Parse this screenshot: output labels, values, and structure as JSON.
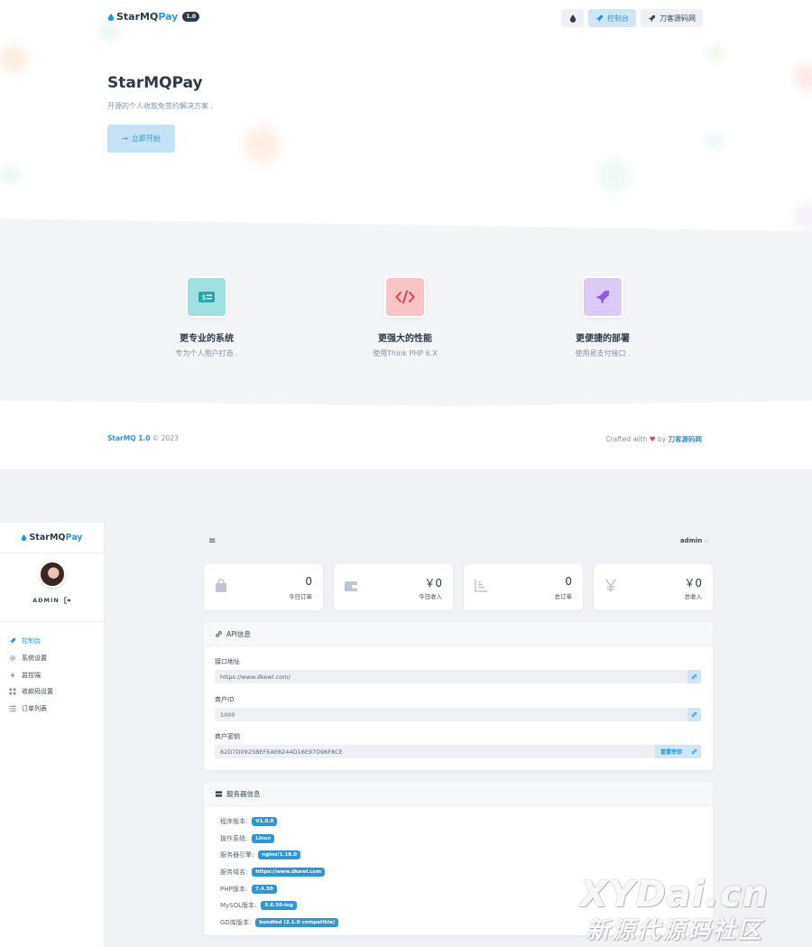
{
  "landing": {
    "logo": {
      "star": "StarMQ",
      "pay": "Pay",
      "version": "1.0"
    },
    "nav": {
      "theme_icon": "drop-icon",
      "console_label": "控制台",
      "site_label": "刀客源码网"
    },
    "hero": {
      "title": "StarMQPay",
      "subtitle": "开源的个人收款免签约解决方案 .",
      "cta_label": "立即开始"
    },
    "features": [
      {
        "icon": "money-icon",
        "color": "#9fe0e0",
        "title": "更专业的系统",
        "desc": "专为个人用户打造 ."
      },
      {
        "icon": "code-icon",
        "color": "#f6c6c6",
        "title": "更强大的性能",
        "desc": "使用Think PHP 6.X"
      },
      {
        "icon": "rocket-icon",
        "color": "#dccbf7",
        "title": "更便捷的部署",
        "desc": "使用易支付接口 ."
      }
    ],
    "footer": {
      "brand": "StarMQ 1.0",
      "copyright": "© 2023",
      "crafted_prefix": "Crafted with",
      "crafted_by": "by",
      "crafted_brand": "刀客源码网"
    }
  },
  "admin": {
    "sidebar": {
      "logo_star": "StarMQ",
      "logo_pay": "Pay",
      "username": "ADMIN",
      "items": [
        {
          "label": "控制台",
          "icon": "rocket-icon",
          "active": true
        },
        {
          "label": "系统设置",
          "icon": "gear-icon",
          "active": false
        },
        {
          "label": "监控端",
          "icon": "bolt-icon",
          "active": false
        },
        {
          "label": "收款码设置",
          "icon": "grid-icon",
          "active": false
        },
        {
          "label": "订单列表",
          "icon": "list-icon",
          "active": false
        }
      ]
    },
    "header": {
      "menu_icon": "≡",
      "user": "admin"
    },
    "stats": [
      {
        "icon": "bag-icon",
        "value": "0",
        "label": "今日订单"
      },
      {
        "icon": "wallet-icon",
        "value": "￥0",
        "label": "今日收入"
      },
      {
        "icon": "chart-icon",
        "value": "0",
        "label": "总订单"
      },
      {
        "icon": "yen-icon",
        "value": "￥0",
        "label": "总收入"
      }
    ],
    "api": {
      "title": "API信息",
      "fields": [
        {
          "label": "接口地址",
          "value": "https://www.dkewl.com/"
        },
        {
          "label": "商户ID",
          "value": "1000"
        },
        {
          "label": "商户密钥",
          "value": "62D7D0925BEFEAE8244D16E97D96F8CE"
        }
      ],
      "reset_label": "重置密钥"
    },
    "server": {
      "title": "服务器信息",
      "rows": [
        {
          "label": "程序版本:",
          "value": "V1.0.0"
        },
        {
          "label": "操作系统:",
          "value": "Linux"
        },
        {
          "label": "服务器引擎:",
          "value": "nginx/1.18.0"
        },
        {
          "label": "服务域名:",
          "value": "https://www.dkewl.com"
        },
        {
          "label": "PHP版本:",
          "value": "7.4.30"
        },
        {
          "label": "MySQL版本:",
          "value": "5.6.50-log"
        },
        {
          "label": "GD库版本:",
          "value": "bundled (2.1.0 compatible)"
        }
      ]
    }
  },
  "watermark": {
    "line1": "XYDai.cn",
    "line2": "新源代源码社区"
  },
  "colors": {
    "accent": "#2f96d6",
    "heart": "#e43f52",
    "dark": "#2f3a49"
  }
}
